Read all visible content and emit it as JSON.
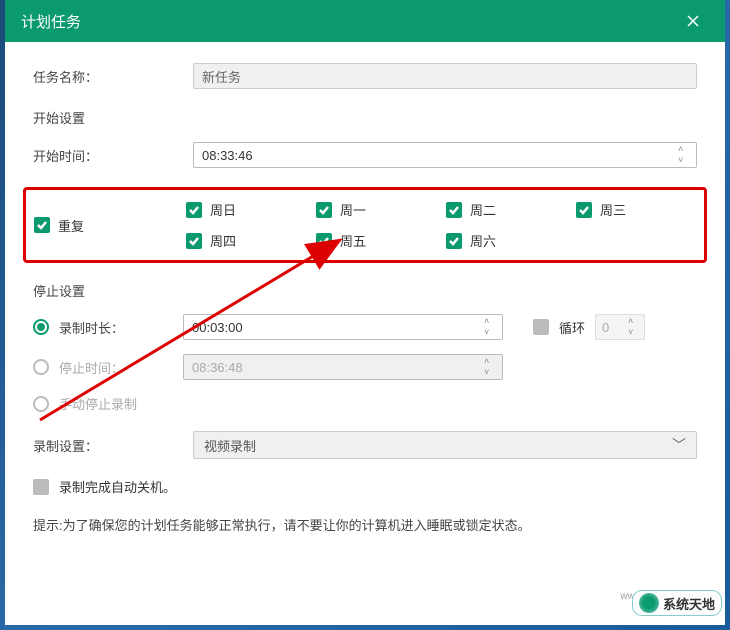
{
  "titlebar": {
    "title": "计划任务"
  },
  "task_name": {
    "label": "任务名称：",
    "value": "新任务"
  },
  "start_section": {
    "header": "开始设置",
    "time_label": "开始时间：",
    "time_value": "08:33:46"
  },
  "repeat": {
    "label": "重复",
    "days": [
      "周日",
      "周一",
      "周二",
      "周三",
      "周四",
      "周五",
      "周六"
    ]
  },
  "stop_section": {
    "header": "停止设置",
    "options": {
      "duration": {
        "label": "录制时长：",
        "value": "00:03:00"
      },
      "stop_time": {
        "label": "停止时间：",
        "value": "08:36:48"
      },
      "manual": {
        "label": "手动停止录制"
      }
    },
    "loop": {
      "label": "循环",
      "value": "0"
    }
  },
  "record_section": {
    "label": "录制设置：",
    "value": "视频录制"
  },
  "auto_shutdown": {
    "label": "录制完成自动关机。"
  },
  "hint": "提示:为了确保您的计划任务能够正常执行，请不要让你的计算机进入睡眠或锁定状态。",
  "watermark": {
    "url": "www.XiTongTianDi.net",
    "text": "系统天地"
  }
}
